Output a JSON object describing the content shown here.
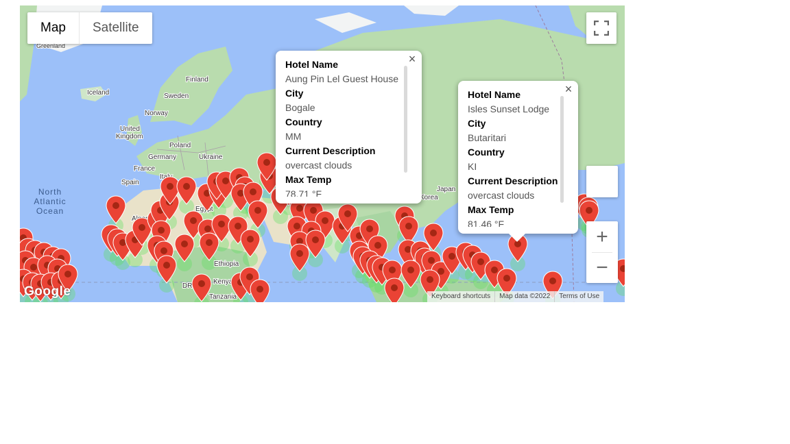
{
  "map_type": {
    "map_label": "Map",
    "satellite_label": "Satellite",
    "selected": "Map"
  },
  "place_labels": {
    "greenland": "Greenland",
    "iceland": "Iceland",
    "finland": "Finland",
    "sweden": "Sweden",
    "norway": "Norway",
    "united_kingdom_1": "United",
    "united_kingdom_2": "Kingdom",
    "poland": "Poland",
    "germany": "Germany",
    "ukraine": "Ukraine",
    "france": "France",
    "italy": "Italy",
    "spain": "Spain",
    "north_atlantic_1": "North",
    "north_atlantic_2": "Atlantic",
    "north_atlantic_3": "Ocean",
    "algeria": "Algeria",
    "egypt": "Egypt",
    "ethiopia": "Ethiopia",
    "kenya": "Kenya",
    "drc": "DRC",
    "tanzania": "Tanzania",
    "japan": "Japan",
    "korea": "Korea"
  },
  "popups": [
    {
      "fields": [
        {
          "key": "Hotel Name",
          "value": "Aung Pin Lel Guest House"
        },
        {
          "key": "City",
          "value": "Bogale"
        },
        {
          "key": "Country",
          "value": "MM"
        },
        {
          "key": "Current Description",
          "value": "overcast clouds"
        },
        {
          "key": "Max Temp",
          "value": "78.71 °F"
        }
      ]
    },
    {
      "fields": [
        {
          "key": "Hotel Name",
          "value": "Isles Sunset Lodge"
        },
        {
          "key": "City",
          "value": "Butaritari"
        },
        {
          "key": "Country",
          "value": "KI"
        },
        {
          "key": "Current Description",
          "value": "overcast clouds"
        },
        {
          "key": "Max Temp",
          "value": "81.46 °F"
        }
      ]
    }
  ],
  "close_glyph": "×",
  "zoom": {
    "in_label": "+",
    "out_label": "−"
  },
  "attribution": {
    "shortcuts": "Keyboard shortcuts",
    "map_data": "Map data ©2022",
    "terms": "Terms of Use"
  },
  "logo_text": "Google",
  "icons": {
    "fullscreen": "fullscreen-icon",
    "pegman": "pegman-icon",
    "marker": "map-marker-icon"
  },
  "colors": {
    "ocean": "#9cc0f9",
    "land": "#a8d5a2",
    "desert": "#eee8d5",
    "ice": "#f2f4f4",
    "marker": "#ea4335",
    "marker_dot": "#a52714",
    "heat": "#5fe05f"
  }
}
